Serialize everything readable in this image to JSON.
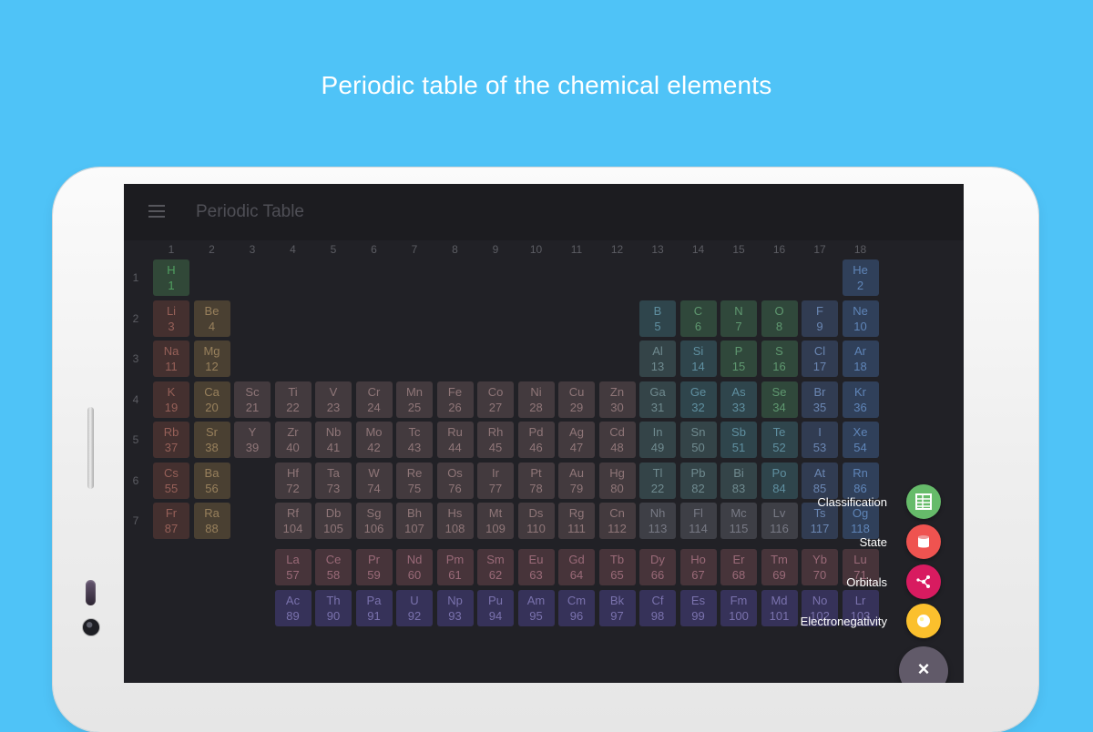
{
  "headline": "Periodic table of the chemical elements",
  "app": {
    "title": "Periodic Table",
    "menu_icon": "menu-icon"
  },
  "groups": [
    "1",
    "2",
    "3",
    "4",
    "5",
    "6",
    "7",
    "8",
    "9",
    "10",
    "11",
    "12",
    "13",
    "14",
    "15",
    "16",
    "17",
    "18"
  ],
  "periods": [
    "1",
    "2",
    "3",
    "4",
    "5",
    "6",
    "7"
  ],
  "category_colors": {
    "hydrogen": {
      "bg": "#314838",
      "fg": "#50a060"
    },
    "noble_gas": {
      "bg": "#30405a",
      "fg": "#5f85b8"
    },
    "alkali_metal": {
      "bg": "#44302f",
      "fg": "#966058"
    },
    "alkaline_earth": {
      "bg": "#4a4032",
      "fg": "#98805c"
    },
    "transition_metal": {
      "bg": "#433a3e",
      "fg": "#8f7678"
    },
    "post_transition": {
      "bg": "#344448",
      "fg": "#6f8a8f"
    },
    "metalloid": {
      "bg": "#2f454c",
      "fg": "#5f8fa0"
    },
    "nonmetal": {
      "bg": "#30483b",
      "fg": "#5f9870"
    },
    "halogen": {
      "bg": "#313c52",
      "fg": "#6a86b2"
    },
    "lanthanide": {
      "bg": "#47343a",
      "fg": "#9a6a78"
    },
    "actinide": {
      "bg": "#363259",
      "fg": "#7a72ad"
    },
    "unknown": {
      "bg": "#3e3f46",
      "fg": "#777984"
    }
  },
  "elements": [
    {
      "symbol": "H",
      "number": "1",
      "group": 1,
      "period": 1,
      "category": "hydrogen"
    },
    {
      "symbol": "He",
      "number": "2",
      "group": 18,
      "period": 1,
      "category": "noble_gas"
    },
    {
      "symbol": "Li",
      "number": "3",
      "group": 1,
      "period": 2,
      "category": "alkali_metal"
    },
    {
      "symbol": "Be",
      "number": "4",
      "group": 2,
      "period": 2,
      "category": "alkaline_earth"
    },
    {
      "symbol": "B",
      "number": "5",
      "group": 13,
      "period": 2,
      "category": "metalloid"
    },
    {
      "symbol": "C",
      "number": "6",
      "group": 14,
      "period": 2,
      "category": "nonmetal"
    },
    {
      "symbol": "N",
      "number": "7",
      "group": 15,
      "period": 2,
      "category": "nonmetal"
    },
    {
      "symbol": "O",
      "number": "8",
      "group": 16,
      "period": 2,
      "category": "nonmetal"
    },
    {
      "symbol": "F",
      "number": "9",
      "group": 17,
      "period": 2,
      "category": "halogen"
    },
    {
      "symbol": "Ne",
      "number": "10",
      "group": 18,
      "period": 2,
      "category": "noble_gas"
    },
    {
      "symbol": "Na",
      "number": "11",
      "group": 1,
      "period": 3,
      "category": "alkali_metal"
    },
    {
      "symbol": "Mg",
      "number": "12",
      "group": 2,
      "period": 3,
      "category": "alkaline_earth"
    },
    {
      "symbol": "Al",
      "number": "13",
      "group": 13,
      "period": 3,
      "category": "post_transition"
    },
    {
      "symbol": "Si",
      "number": "14",
      "group": 14,
      "period": 3,
      "category": "metalloid"
    },
    {
      "symbol": "P",
      "number": "15",
      "group": 15,
      "period": 3,
      "category": "nonmetal"
    },
    {
      "symbol": "S",
      "number": "16",
      "group": 16,
      "period": 3,
      "category": "nonmetal"
    },
    {
      "symbol": "Cl",
      "number": "17",
      "group": 17,
      "period": 3,
      "category": "halogen"
    },
    {
      "symbol": "Ar",
      "number": "18",
      "group": 18,
      "period": 3,
      "category": "noble_gas"
    },
    {
      "symbol": "K",
      "number": "19",
      "group": 1,
      "period": 4,
      "category": "alkali_metal"
    },
    {
      "symbol": "Ca",
      "number": "20",
      "group": 2,
      "period": 4,
      "category": "alkaline_earth"
    },
    {
      "symbol": "Sc",
      "number": "21",
      "group": 3,
      "period": 4,
      "category": "transition_metal"
    },
    {
      "symbol": "Ti",
      "number": "22",
      "group": 4,
      "period": 4,
      "category": "transition_metal"
    },
    {
      "symbol": "V",
      "number": "23",
      "group": 5,
      "period": 4,
      "category": "transition_metal"
    },
    {
      "symbol": "Cr",
      "number": "24",
      "group": 6,
      "period": 4,
      "category": "transition_metal"
    },
    {
      "symbol": "Mn",
      "number": "25",
      "group": 7,
      "period": 4,
      "category": "transition_metal"
    },
    {
      "symbol": "Fe",
      "number": "26",
      "group": 8,
      "period": 4,
      "category": "transition_metal"
    },
    {
      "symbol": "Co",
      "number": "27",
      "group": 9,
      "period": 4,
      "category": "transition_metal"
    },
    {
      "symbol": "Ni",
      "number": "28",
      "group": 10,
      "period": 4,
      "category": "transition_metal"
    },
    {
      "symbol": "Cu",
      "number": "29",
      "group": 11,
      "period": 4,
      "category": "transition_metal"
    },
    {
      "symbol": "Zn",
      "number": "30",
      "group": 12,
      "period": 4,
      "category": "transition_metal"
    },
    {
      "symbol": "Ga",
      "number": "31",
      "group": 13,
      "period": 4,
      "category": "post_transition"
    },
    {
      "symbol": "Ge",
      "number": "32",
      "group": 14,
      "period": 4,
      "category": "metalloid"
    },
    {
      "symbol": "As",
      "number": "33",
      "group": 15,
      "period": 4,
      "category": "metalloid"
    },
    {
      "symbol": "Se",
      "number": "34",
      "group": 16,
      "period": 4,
      "category": "nonmetal"
    },
    {
      "symbol": "Br",
      "number": "35",
      "group": 17,
      "period": 4,
      "category": "halogen"
    },
    {
      "symbol": "Kr",
      "number": "36",
      "group": 18,
      "period": 4,
      "category": "noble_gas"
    },
    {
      "symbol": "Rb",
      "number": "37",
      "group": 1,
      "period": 5,
      "category": "alkali_metal"
    },
    {
      "symbol": "Sr",
      "number": "38",
      "group": 2,
      "period": 5,
      "category": "alkaline_earth"
    },
    {
      "symbol": "Y",
      "number": "39",
      "group": 3,
      "period": 5,
      "category": "transition_metal"
    },
    {
      "symbol": "Zr",
      "number": "40",
      "group": 4,
      "period": 5,
      "category": "transition_metal"
    },
    {
      "symbol": "Nb",
      "number": "41",
      "group": 5,
      "period": 5,
      "category": "transition_metal"
    },
    {
      "symbol": "Mo",
      "number": "42",
      "group": 6,
      "period": 5,
      "category": "transition_metal"
    },
    {
      "symbol": "Tc",
      "number": "43",
      "group": 7,
      "period": 5,
      "category": "transition_metal"
    },
    {
      "symbol": "Ru",
      "number": "44",
      "group": 8,
      "period": 5,
      "category": "transition_metal"
    },
    {
      "symbol": "Rh",
      "number": "45",
      "group": 9,
      "period": 5,
      "category": "transition_metal"
    },
    {
      "symbol": "Pd",
      "number": "46",
      "group": 10,
      "period": 5,
      "category": "transition_metal"
    },
    {
      "symbol": "Ag",
      "number": "47",
      "group": 11,
      "period": 5,
      "category": "transition_metal"
    },
    {
      "symbol": "Cd",
      "number": "48",
      "group": 12,
      "period": 5,
      "category": "transition_metal"
    },
    {
      "symbol": "In",
      "number": "49",
      "group": 13,
      "period": 5,
      "category": "post_transition"
    },
    {
      "symbol": "Sn",
      "number": "50",
      "group": 14,
      "period": 5,
      "category": "post_transition"
    },
    {
      "symbol": "Sb",
      "number": "51",
      "group": 15,
      "period": 5,
      "category": "metalloid"
    },
    {
      "symbol": "Te",
      "number": "52",
      "group": 16,
      "period": 5,
      "category": "metalloid"
    },
    {
      "symbol": "I",
      "number": "53",
      "group": 17,
      "period": 5,
      "category": "halogen"
    },
    {
      "symbol": "Xe",
      "number": "54",
      "group": 18,
      "period": 5,
      "category": "noble_gas"
    },
    {
      "symbol": "Cs",
      "number": "55",
      "group": 1,
      "period": 6,
      "category": "alkali_metal"
    },
    {
      "symbol": "Ba",
      "number": "56",
      "group": 2,
      "period": 6,
      "category": "alkaline_earth"
    },
    {
      "symbol": "Hf",
      "number": "72",
      "group": 4,
      "period": 6,
      "category": "transition_metal"
    },
    {
      "symbol": "Ta",
      "number": "73",
      "group": 5,
      "period": 6,
      "category": "transition_metal"
    },
    {
      "symbol": "W",
      "number": "74",
      "group": 6,
      "period": 6,
      "category": "transition_metal"
    },
    {
      "symbol": "Re",
      "number": "75",
      "group": 7,
      "period": 6,
      "category": "transition_metal"
    },
    {
      "symbol": "Os",
      "number": "76",
      "group": 8,
      "period": 6,
      "category": "transition_metal"
    },
    {
      "symbol": "Ir",
      "number": "77",
      "group": 9,
      "period": 6,
      "category": "transition_metal"
    },
    {
      "symbol": "Pt",
      "number": "78",
      "group": 10,
      "period": 6,
      "category": "transition_metal"
    },
    {
      "symbol": "Au",
      "number": "79",
      "group": 11,
      "period": 6,
      "category": "transition_metal"
    },
    {
      "symbol": "Hg",
      "number": "80",
      "group": 12,
      "period": 6,
      "category": "transition_metal"
    },
    {
      "symbol": "Tl",
      "number": "22",
      "group": 13,
      "period": 6,
      "category": "post_transition"
    },
    {
      "symbol": "Pb",
      "number": "82",
      "group": 14,
      "period": 6,
      "category": "post_transition"
    },
    {
      "symbol": "Bi",
      "number": "83",
      "group": 15,
      "period": 6,
      "category": "post_transition"
    },
    {
      "symbol": "Po",
      "number": "84",
      "group": 16,
      "period": 6,
      "category": "metalloid"
    },
    {
      "symbol": "At",
      "number": "85",
      "group": 17,
      "period": 6,
      "category": "halogen"
    },
    {
      "symbol": "Rn",
      "number": "86",
      "group": 18,
      "period": 6,
      "category": "noble_gas"
    },
    {
      "symbol": "Fr",
      "number": "87",
      "group": 1,
      "period": 7,
      "category": "alkali_metal"
    },
    {
      "symbol": "Ra",
      "number": "88",
      "group": 2,
      "period": 7,
      "category": "alkaline_earth"
    },
    {
      "symbol": "Rf",
      "number": "104",
      "group": 4,
      "period": 7,
      "category": "transition_metal"
    },
    {
      "symbol": "Db",
      "number": "105",
      "group": 5,
      "period": 7,
      "category": "transition_metal"
    },
    {
      "symbol": "Sg",
      "number": "106",
      "group": 6,
      "period": 7,
      "category": "transition_metal"
    },
    {
      "symbol": "Bh",
      "number": "107",
      "group": 7,
      "period": 7,
      "category": "transition_metal"
    },
    {
      "symbol": "Hs",
      "number": "108",
      "group": 8,
      "period": 7,
      "category": "transition_metal"
    },
    {
      "symbol": "Mt",
      "number": "109",
      "group": 9,
      "period": 7,
      "category": "transition_metal"
    },
    {
      "symbol": "Ds",
      "number": "110",
      "group": 10,
      "period": 7,
      "category": "transition_metal"
    },
    {
      "symbol": "Rg",
      "number": "111",
      "group": 11,
      "period": 7,
      "category": "transition_metal"
    },
    {
      "symbol": "Cn",
      "number": "112",
      "group": 12,
      "period": 7,
      "category": "transition_metal"
    },
    {
      "symbol": "Nh",
      "number": "113",
      "group": 13,
      "period": 7,
      "category": "unknown"
    },
    {
      "symbol": "Fl",
      "number": "114",
      "group": 14,
      "period": 7,
      "category": "unknown"
    },
    {
      "symbol": "Mc",
      "number": "115",
      "group": 15,
      "period": 7,
      "category": "unknown"
    },
    {
      "symbol": "Lv",
      "number": "116",
      "group": 16,
      "period": 7,
      "category": "unknown"
    },
    {
      "symbol": "Ts",
      "number": "117",
      "group": 17,
      "period": 7,
      "category": "halogen"
    },
    {
      "symbol": "Og",
      "number": "118",
      "group": 18,
      "period": 7,
      "category": "noble_gas"
    }
  ],
  "lanthanides": [
    {
      "symbol": "La",
      "number": "57"
    },
    {
      "symbol": "Ce",
      "number": "58"
    },
    {
      "symbol": "Pr",
      "number": "59"
    },
    {
      "symbol": "Nd",
      "number": "60"
    },
    {
      "symbol": "Pm",
      "number": "61"
    },
    {
      "symbol": "Sm",
      "number": "62"
    },
    {
      "symbol": "Eu",
      "number": "63"
    },
    {
      "symbol": "Gd",
      "number": "64"
    },
    {
      "symbol": "Tb",
      "number": "65"
    },
    {
      "symbol": "Dy",
      "number": "66"
    },
    {
      "symbol": "Ho",
      "number": "67"
    },
    {
      "symbol": "Er",
      "number": "68"
    },
    {
      "symbol": "Tm",
      "number": "69"
    },
    {
      "symbol": "Yb",
      "number": "70"
    },
    {
      "symbol": "Lu",
      "number": "71"
    }
  ],
  "actinides": [
    {
      "symbol": "Ac",
      "number": "89"
    },
    {
      "symbol": "Th",
      "number": "90"
    },
    {
      "symbol": "Pa",
      "number": "91"
    },
    {
      "symbol": "U",
      "number": "92"
    },
    {
      "symbol": "Np",
      "number": "93"
    },
    {
      "symbol": "Pu",
      "number": "94"
    },
    {
      "symbol": "Am",
      "number": "95"
    },
    {
      "symbol": "Cm",
      "number": "96"
    },
    {
      "symbol": "Bk",
      "number": "97"
    },
    {
      "symbol": "Cf",
      "number": "98"
    },
    {
      "symbol": "Es",
      "number": "99"
    },
    {
      "symbol": "Fm",
      "number": "100"
    },
    {
      "symbol": "Md",
      "number": "101"
    },
    {
      "symbol": "No",
      "number": "102"
    },
    {
      "symbol": "Lr",
      "number": "103"
    }
  ],
  "fab": {
    "items": [
      {
        "label": "Classification",
        "icon": "classification-icon",
        "color": "#66bb6a"
      },
      {
        "label": "State",
        "icon": "state-icon",
        "color": "#ef5350"
      },
      {
        "label": "Orbitals",
        "icon": "orbitals-icon",
        "color": "#d81b60"
      },
      {
        "label": "Electronegativity",
        "icon": "electronegativity-icon",
        "color": "#fbc02d"
      }
    ],
    "close_icon": "close-icon",
    "close_glyph": "×",
    "main_color": "#615a69"
  }
}
